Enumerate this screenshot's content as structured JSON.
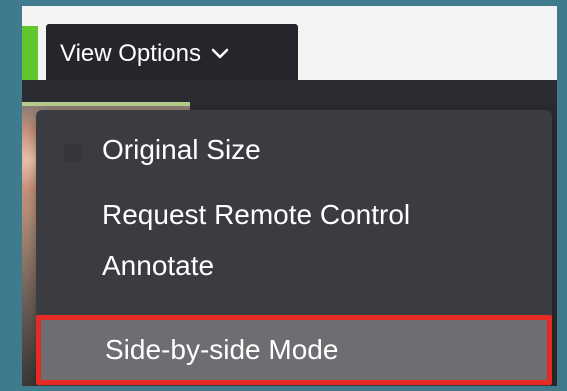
{
  "view_options": {
    "label": "View Options",
    "icon": "chevron-down-icon"
  },
  "menu": {
    "items": [
      {
        "label": "Original Size"
      },
      {
        "label": "Request Remote Control"
      },
      {
        "label": "Annotate"
      },
      {
        "label": "Side-by-side Mode"
      }
    ]
  },
  "colors": {
    "background": "#3f7b8c",
    "panel": "#f4f4f4",
    "dropdown": "#24262b",
    "menu": "#3a3c41",
    "highlight": "#6d6e72",
    "outline": "#e52b24",
    "accent": "#5fc62d"
  }
}
